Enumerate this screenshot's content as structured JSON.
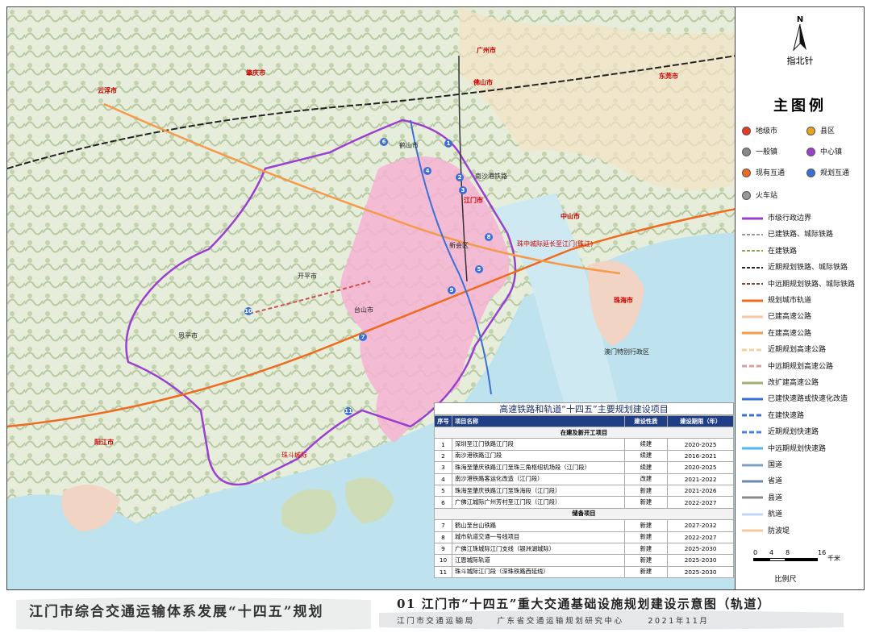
{
  "colors": {
    "purple_boundary": "#9a3fd0",
    "urban_pink": "#f6b3d2",
    "sea": "#bfe3ee",
    "rail_orange": "#f06a1e",
    "header_blue": "#1f3e86"
  },
  "map_labels": {
    "guangzhou": "广州市",
    "foshan": "佛山市",
    "zhaoqing": "肇庆市",
    "yunfu": "云浮市",
    "dongguan": "东莞市",
    "zhongshan": "中山市",
    "zhuhai": "珠海市",
    "yangjiang": "阳江市",
    "jiangmen": "江门市",
    "hengqin": "澳门特别行政区",
    "rail_line": "南沙港铁路",
    "xinhui": "新会区",
    "heshan": "鹤山市",
    "kaiping": "开平市",
    "enping": "恩平市",
    "taishan": "台山市",
    "rail2": "珠中城际延长至江门(珠江)",
    "rail3": "珠斗城际"
  },
  "markers": [
    "1",
    "2",
    "3",
    "4",
    "5",
    "6",
    "7",
    "8",
    "9",
    "10",
    "11"
  ],
  "north": {
    "symbol": "N",
    "label": "指北针"
  },
  "legend": {
    "title": "主图例",
    "points": [
      {
        "label": "地级市",
        "icon": "prefecture-city-icon"
      },
      {
        "label": "县区",
        "icon": "county-icon"
      },
      {
        "label": "一般镇",
        "icon": "town-icon"
      },
      {
        "label": "中心镇",
        "icon": "central-town-icon"
      },
      {
        "label": "现有互通",
        "icon": "existing-interchange-icon"
      },
      {
        "label": "规划互通",
        "icon": "planned-interchange-icon"
      },
      {
        "label": "火车站",
        "icon": "train-station-icon"
      }
    ],
    "lines": [
      {
        "label": "市级行政边界",
        "color": "#9a3fd0",
        "style": "solid"
      },
      {
        "label": "已建铁路、城际铁路",
        "color": "#999999",
        "style": "rail"
      },
      {
        "label": "在建铁路",
        "color": "#8aa85a",
        "style": "rail"
      },
      {
        "label": "近期规划铁路、城际铁路",
        "color": "#222222",
        "style": "rail"
      },
      {
        "label": "中远期规划铁路、城际铁路",
        "color": "#7a4a2a",
        "style": "rail"
      },
      {
        "label": "规划城市轨道",
        "color": "#f06a1e",
        "style": "solid"
      },
      {
        "label": "已建高速公路",
        "color": "#f7c8a8",
        "style": "solid"
      },
      {
        "label": "在建高速公路",
        "color": "#f49a4a",
        "style": "solid"
      },
      {
        "label": "近期规划高速公路",
        "color": "#f5cfa0",
        "style": "dash"
      },
      {
        "label": "中远期规划高速公路",
        "color": "#d8a0a0",
        "style": "dash"
      },
      {
        "label": "改扩建高速公路",
        "color": "#a0b070",
        "style": "solid"
      },
      {
        "label": "已建快速路或快速化改造",
        "color": "#3a6fd8",
        "style": "solid"
      },
      {
        "label": "在建快速路",
        "color": "#3a6fd8",
        "style": "dash"
      },
      {
        "label": "近期规划快速路",
        "color": "#4a80e0",
        "style": "dash"
      },
      {
        "label": "中远期规划快速路",
        "color": "#4fb8f0",
        "style": "solid"
      },
      {
        "label": "国道",
        "color": "#7aa0c8",
        "style": "solid"
      },
      {
        "label": "省道",
        "color": "#6a8ab0",
        "style": "solid"
      },
      {
        "label": "县道",
        "color": "#8a8a8a",
        "style": "solid"
      },
      {
        "label": "航道",
        "color": "#c0d8f8",
        "style": "solid"
      },
      {
        "label": "防波堤",
        "color": "#f5c8a0",
        "style": "solid"
      }
    ]
  },
  "scale": {
    "ticks": [
      "0",
      "4",
      "8",
      "16"
    ],
    "unit": "千米",
    "label": "比例尺"
  },
  "table": {
    "title": "高速铁路和轨道“十四五”主要规划建设项目",
    "headers": [
      "序号",
      "项目名称",
      "建设性质",
      "建设期限（年）"
    ],
    "sections": [
      {
        "name": "在建及新开工项目",
        "rows": [
          {
            "no": "1",
            "name": "深圳至江门铁路江门段",
            "type": "续建",
            "period": "2020-2025"
          },
          {
            "no": "2",
            "name": "南沙港铁路江门段",
            "type": "续建",
            "period": "2016-2021"
          },
          {
            "no": "3",
            "name": "珠海至肇庆铁路江门至珠三角枢纽机场段（江门段）",
            "type": "续建",
            "period": "2020-2025"
          },
          {
            "no": "4",
            "name": "南沙港铁路客运化改造（江门段）",
            "type": "改建",
            "period": "2021-2022"
          },
          {
            "no": "5",
            "name": "珠海至肇庆铁路江门至珠海段（江门段）",
            "type": "新建",
            "period": "2021-2026"
          },
          {
            "no": "6",
            "name": "广佛江城际广州芳村至江门段（江门段）",
            "type": "新建",
            "period": "2022-2027"
          }
        ]
      },
      {
        "name": "储备项目",
        "rows": [
          {
            "no": "7",
            "name": "鹤山至台山铁路",
            "type": "新建",
            "period": "2027-2032"
          },
          {
            "no": "8",
            "name": "城市轨道交通一号线项目",
            "type": "新建",
            "period": "2022-2027"
          },
          {
            "no": "9",
            "name": "广佛江珠城际江门支线（银洲湖城际）",
            "type": "新建",
            "period": "2025-2030"
          },
          {
            "no": "10",
            "name": "江恩城际轨道",
            "type": "新建",
            "period": "2025-2030"
          },
          {
            "no": "11",
            "name": "珠斗城际江门段（深珠铁路西延线）",
            "type": "新建",
            "period": "2025-2030"
          }
        ]
      }
    ]
  },
  "footer": {
    "left": "江门市综合交通运输体系发展“十四五”规划",
    "right_title": "01  江门市“十四五”重大交通基础设施规划建设示意图（轨道）",
    "right_org1": "江门市交通运输局",
    "right_org2": "广东省交通运输规划研究中心",
    "right_date": "2021年11月"
  }
}
